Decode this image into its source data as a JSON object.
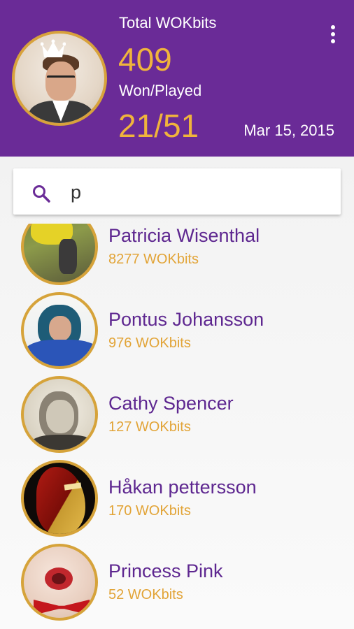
{
  "header": {
    "total_label": "Total WOKbits",
    "total_value": "409",
    "won_played_label": "Won/Played",
    "won_played_value": "21/51",
    "date": "Mar 15, 2015",
    "accent_color": "#6a2b97",
    "value_color": "#f0b43c",
    "menu_icon": "overflow-menu-icon",
    "crown_icon": "crown-icon"
  },
  "search": {
    "value": "p",
    "icon": "search-icon"
  },
  "players": [
    {
      "name": "Patricia Wisenthal",
      "bits": "8277 WOKbits"
    },
    {
      "name": "Pontus Johansson",
      "bits": "976 WOKbits"
    },
    {
      "name": "Cathy Spencer",
      "bits": "127 WOKbits"
    },
    {
      "name": "Håkan pettersson",
      "bits": "170 WOKbits"
    },
    {
      "name": "Princess Pink",
      "bits": "52 WOKbits"
    }
  ]
}
